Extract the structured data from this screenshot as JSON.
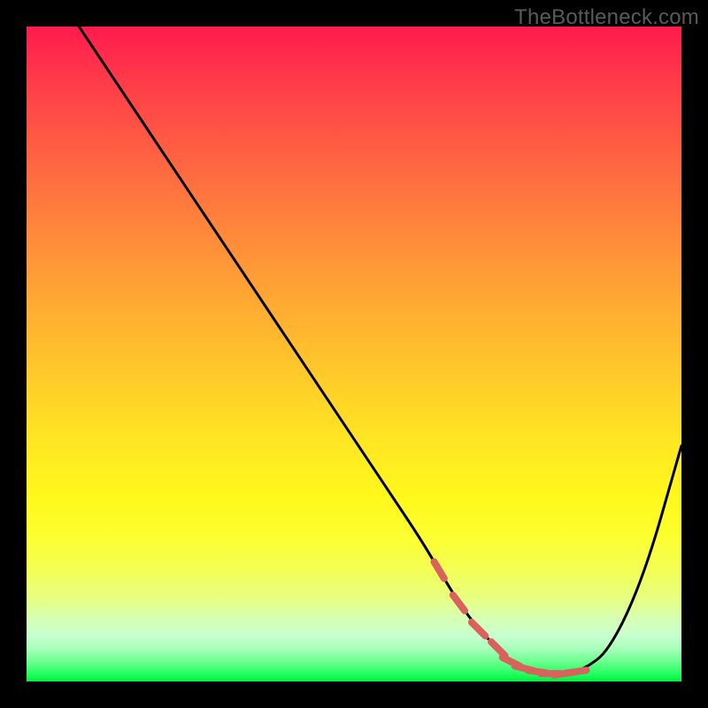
{
  "watermark": "TheBottleneck.com",
  "colors": {
    "frame": "#000000",
    "curve": "#000000",
    "marker": "#d9625e"
  },
  "chart_data": {
    "type": "line",
    "title": "",
    "xlabel": "",
    "ylabel": "",
    "xlim": [
      0,
      100
    ],
    "ylim": [
      0,
      100
    ],
    "grid": false,
    "legend": false,
    "x": [
      8,
      12,
      16,
      20,
      24,
      28,
      32,
      36,
      40,
      44,
      48,
      52,
      56,
      60,
      63,
      66,
      69,
      72,
      74,
      76,
      78,
      80,
      82,
      84,
      86,
      88,
      90,
      92,
      94,
      96,
      98,
      100
    ],
    "y": [
      100,
      94,
      88,
      82,
      76,
      70,
      64,
      58,
      52,
      46,
      40,
      34,
      28,
      22,
      17,
      12,
      8,
      5,
      3,
      2,
      1.5,
      1.2,
      1.2,
      1.5,
      2.5,
      4,
      7,
      11,
      16,
      22,
      29,
      36
    ],
    "markers": {
      "x": [
        63,
        66,
        69,
        72,
        74,
        76,
        78,
        80,
        82,
        84
      ],
      "y": [
        17,
        12,
        8,
        5,
        3,
        2,
        1.5,
        1.2,
        1.2,
        1.5
      ],
      "note": "plateau markers near minimum"
    },
    "background_gradient": [
      {
        "pos": 0,
        "color": "#ff1a4d"
      },
      {
        "pos": 50,
        "color": "#ffd228"
      },
      {
        "pos": 80,
        "color": "#fcff30"
      },
      {
        "pos": 100,
        "color": "#00f040"
      }
    ]
  }
}
